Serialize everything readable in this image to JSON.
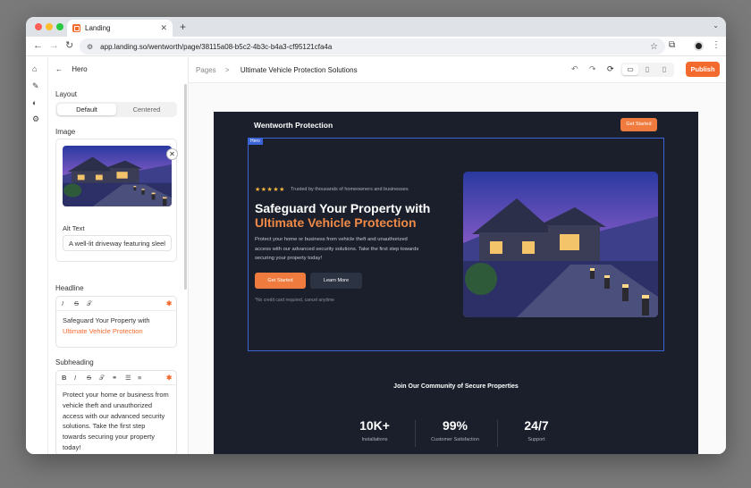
{
  "browser": {
    "tab_title": "Landing",
    "url": "app.landing.so/wentworth/page/38115a08-b5c2-4b3c-b4a3-cf95121cfa4a",
    "new_tab_glyph": "+",
    "tab_close_glyph": "✕"
  },
  "panel": {
    "title": "Hero",
    "layout_label": "Layout",
    "layout_options": [
      "Default",
      "Centered"
    ],
    "image_label": "Image",
    "alt_text_label": "Alt Text",
    "alt_text_value": "A well-lit driveway featuring sleel",
    "headline_label": "Headline",
    "headline_line1": "Safeguard Your Property with",
    "headline_line2": "Ultimate Vehicle Protection",
    "subheading_label": "Subheading",
    "subheading_text": "Protect your home or business from vehicle theft and unauthorized access with our advanced security solutions. Take the first step towards securing your property today!"
  },
  "topbar": {
    "breadcrumb_root": "Pages",
    "breadcrumb_sep": ">",
    "breadcrumb_current": "Ultimate Vehicle Protection Solutions",
    "publish_label": "Publish"
  },
  "site": {
    "brand": "Wentworth Protection",
    "nav_cta": "Get Started",
    "section_tag": "Hero",
    "stars": "★★★★★",
    "trusted": "Trusted by thousands of homeowners and businesses",
    "headline_line1": "Safeguard Your Property with",
    "headline_line2": "Ultimate Vehicle Protection",
    "subheading": "Protect your home or business from vehicle theft and unauthorized access with our advanced security solutions. Take the first step towards securing your property today!",
    "cta_primary": "Get Started",
    "cta_secondary": "Learn More",
    "fine_print": "*No credit card required, cancel anytime",
    "community_heading": "Join Our Community of Secure Properties",
    "stats": [
      {
        "value": "10K+",
        "label": "Installations"
      },
      {
        "value": "99%",
        "label": "Customer Satisfaction"
      },
      {
        "value": "24/7",
        "label": "Support"
      }
    ]
  },
  "colors": {
    "accent": "#f26a2e",
    "site_bg": "#1a1f2b",
    "selection": "#3b64d6"
  }
}
